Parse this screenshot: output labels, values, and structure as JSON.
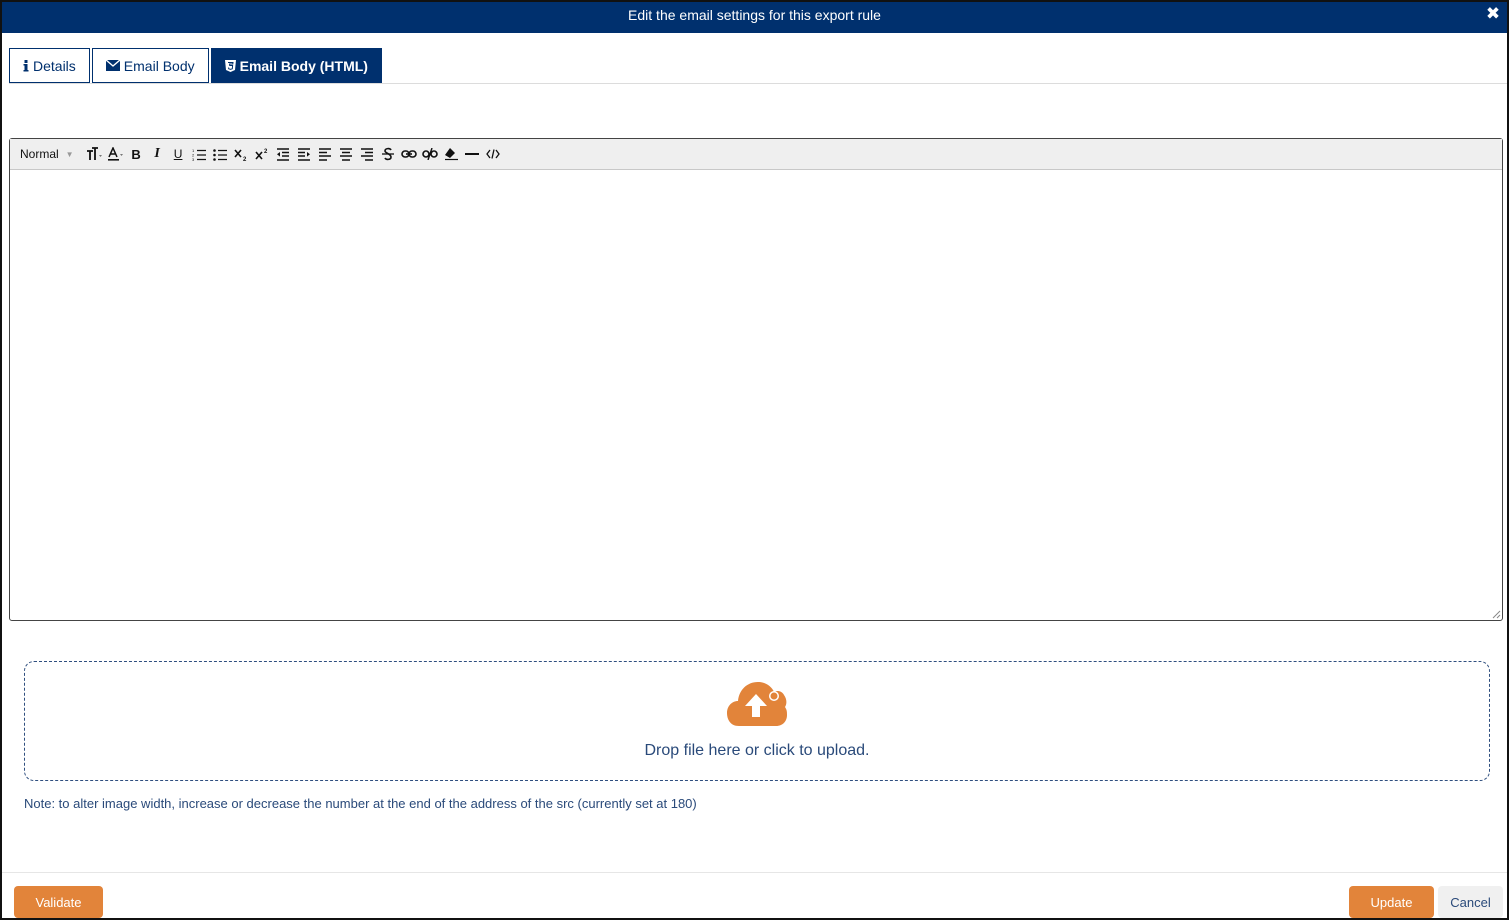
{
  "modal": {
    "title": "Edit the email settings for this export rule"
  },
  "tabs": [
    {
      "label": "Details",
      "icon": "info-icon",
      "active": false
    },
    {
      "label": "Email Body",
      "icon": "envelope-icon",
      "active": false
    },
    {
      "label": "Email Body (HTML)",
      "icon": "html5-icon",
      "active": true
    }
  ],
  "toolbar": {
    "paragraph_style": "Normal",
    "bold_label": "B",
    "italic_label": "I",
    "underline_label": "U",
    "buttons": [
      "font-size-icon",
      "text-color-icon",
      "bold-icon",
      "italic-icon",
      "underline-icon",
      "ordered-list-icon",
      "unordered-list-icon",
      "subscript-icon",
      "superscript-icon",
      "outdent-icon",
      "indent-icon",
      "align-left-icon",
      "align-center-icon",
      "align-right-icon",
      "strikethrough-icon",
      "link-icon",
      "unlink-icon",
      "clear-format-icon",
      "horizontal-rule-icon",
      "code-view-icon"
    ]
  },
  "upload": {
    "text": "Drop file here or click to upload."
  },
  "note": "Note: to alter image width, increase or decrease the number at the end of the address of the src (currently set at 180)",
  "footer": {
    "validate_label": "Validate",
    "update_label": "Update",
    "cancel_label": "Cancel"
  },
  "colors": {
    "primary": "#00306e",
    "accent": "#e2843a",
    "text": "#2a4a7a"
  }
}
